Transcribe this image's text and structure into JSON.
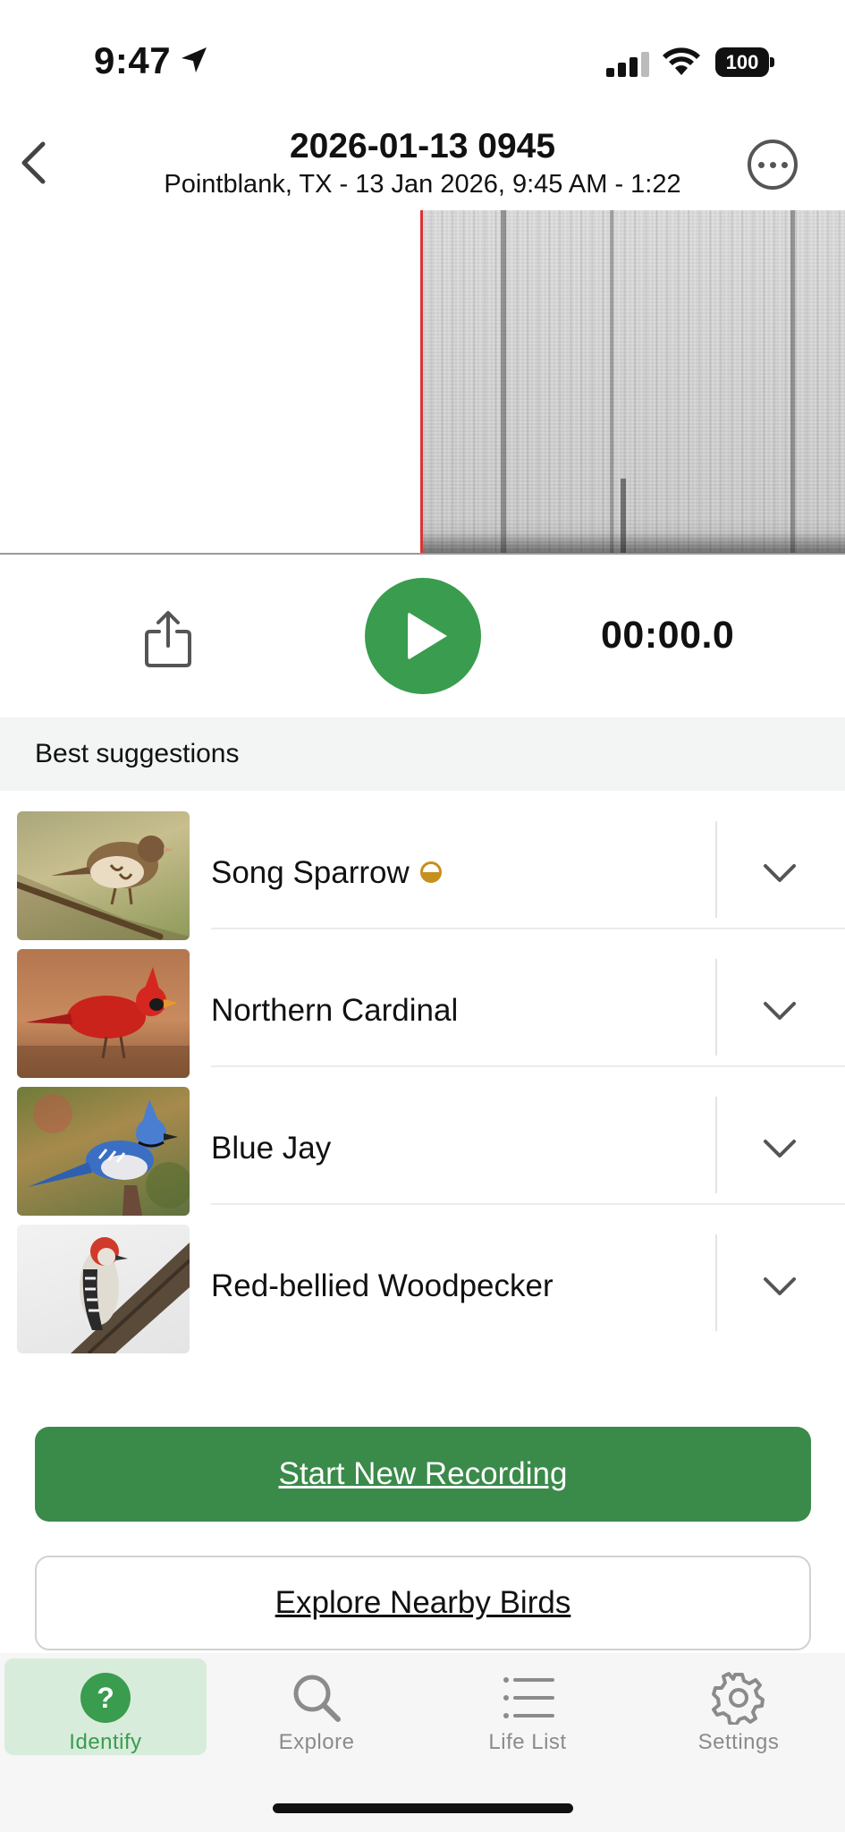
{
  "status_bar": {
    "time": "9:47",
    "battery": "100"
  },
  "header": {
    "title": "2026-01-13 0945",
    "subtitle": "Pointblank, TX - 13 Jan 2026, 9:45 AM - 1:22"
  },
  "playback": {
    "timer": "00:00.0"
  },
  "suggestions": {
    "label": "Best suggestions",
    "items": [
      {
        "name": "Song Sparrow",
        "badge": "half-circle-badge"
      },
      {
        "name": "Northern Cardinal"
      },
      {
        "name": "Blue Jay"
      },
      {
        "name": "Red-bellied Woodpecker"
      }
    ]
  },
  "actions": {
    "start_recording": "Start New Recording",
    "explore_nearby": "Explore Nearby Birds"
  },
  "tabbar": {
    "tabs": [
      {
        "label": "Identify",
        "icon": "question-circle-icon",
        "active": true
      },
      {
        "label": "Explore",
        "icon": "search-icon"
      },
      {
        "label": "Life List",
        "icon": "list-icon"
      },
      {
        "label": "Settings",
        "icon": "gear-icon"
      }
    ]
  },
  "colors": {
    "accent_green": "#3a9c4e",
    "button_green": "#3a8a4a",
    "playhead_red": "#d33333",
    "badge_gold": "#c7901c"
  }
}
